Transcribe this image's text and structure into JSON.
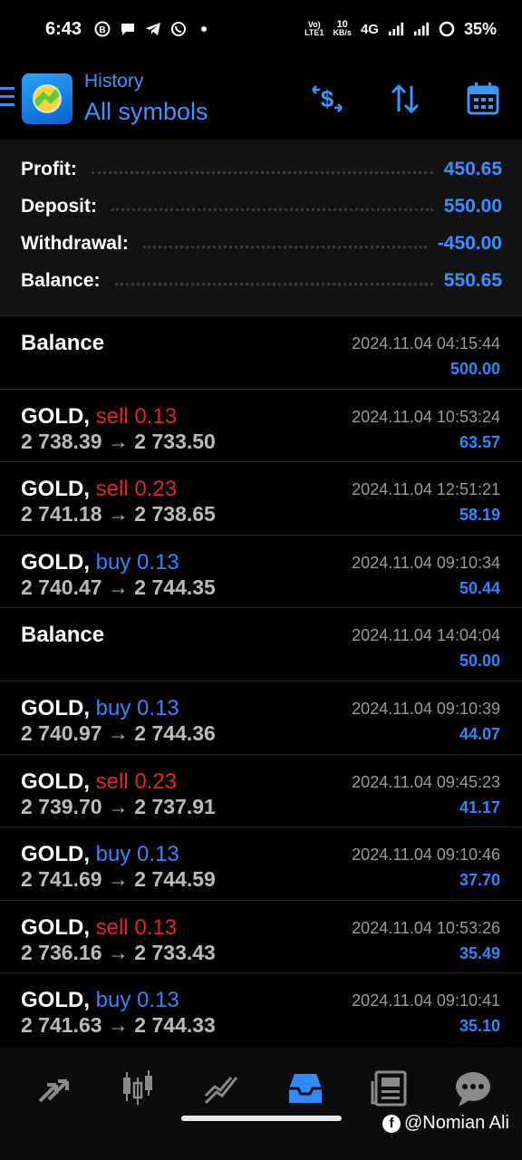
{
  "status_bar": {
    "time": "6:43",
    "network_top": "Vo)",
    "network_bottom": "LTE1",
    "speed_top": "10",
    "speed_bottom": "KB/s",
    "net_type": "4G",
    "battery": "35%",
    "notification_icons": [
      "b-icon",
      "chat-icon",
      "telegram-icon",
      "whatsapp-icon",
      "dot-icon"
    ]
  },
  "header": {
    "subtitle": "History",
    "title": "All symbols",
    "actions": [
      "deposit-dollar-icon",
      "sort-icon",
      "calendar-icon"
    ]
  },
  "summary": {
    "rows": [
      {
        "label": "Profit:",
        "value": "450.65"
      },
      {
        "label": "Deposit:",
        "value": "550.00"
      },
      {
        "label": "Withdrawal:",
        "value": "-450.00"
      },
      {
        "label": "Balance:",
        "value": "550.65"
      }
    ]
  },
  "deals": [
    {
      "kind": "balance",
      "symbol": "Balance",
      "time": "2024.11.04 04:15:44",
      "profit": "500.00"
    },
    {
      "kind": "trade",
      "symbol": "GOLD,",
      "side": "sell",
      "volume": "0.13",
      "prices": "2 738.39 → 2 733.50",
      "time": "2024.11.04 10:53:24",
      "profit": "63.57"
    },
    {
      "kind": "trade",
      "symbol": "GOLD,",
      "side": "sell",
      "volume": "0.23",
      "prices": "2 741.18 → 2 738.65",
      "time": "2024.11.04 12:51:21",
      "profit": "58.19"
    },
    {
      "kind": "trade",
      "symbol": "GOLD,",
      "side": "buy",
      "volume": "0.13",
      "prices": "2 740.47 → 2 744.35",
      "time": "2024.11.04 09:10:34",
      "profit": "50.44"
    },
    {
      "kind": "balance",
      "symbol": "Balance",
      "time": "2024.11.04 14:04:04",
      "profit": "50.00"
    },
    {
      "kind": "trade",
      "symbol": "GOLD,",
      "side": "buy",
      "volume": "0.13",
      "prices": "2 740.97 → 2 744.36",
      "time": "2024.11.04 09:10:39",
      "profit": "44.07"
    },
    {
      "kind": "trade",
      "symbol": "GOLD,",
      "side": "sell",
      "volume": "0.23",
      "prices": "2 739.70 → 2 737.91",
      "time": "2024.11.04 09:45:23",
      "profit": "41.17"
    },
    {
      "kind": "trade",
      "symbol": "GOLD,",
      "side": "buy",
      "volume": "0.13",
      "prices": "2 741.69 → 2 744.59",
      "time": "2024.11.04 09:10:46",
      "profit": "37.70"
    },
    {
      "kind": "trade",
      "symbol": "GOLD,",
      "side": "sell",
      "volume": "0.13",
      "prices": "2 736.16 → 2 733.43",
      "time": "2024.11.04 10:53:26",
      "profit": "35.49"
    },
    {
      "kind": "trade",
      "symbol": "GOLD,",
      "side": "buy",
      "volume": "0.13",
      "prices": "2 741.63 → 2 744.33",
      "time": "2024.11.04 09:10:41",
      "profit": "35.10"
    }
  ],
  "bottom_nav": {
    "items": [
      "quotes-arrows-icon",
      "chart-candles-icon",
      "trade-icon",
      "history-inbox-icon",
      "news-icon",
      "messages-icon"
    ],
    "active": "history-inbox-icon"
  },
  "watermark": {
    "text": "@Nomian Ali",
    "icon": "facebook-icon"
  },
  "colors": {
    "accent": "#3b95ff",
    "sell": "#e0262b",
    "buy": "#2f86ff",
    "muted": "#9a9a9a"
  }
}
